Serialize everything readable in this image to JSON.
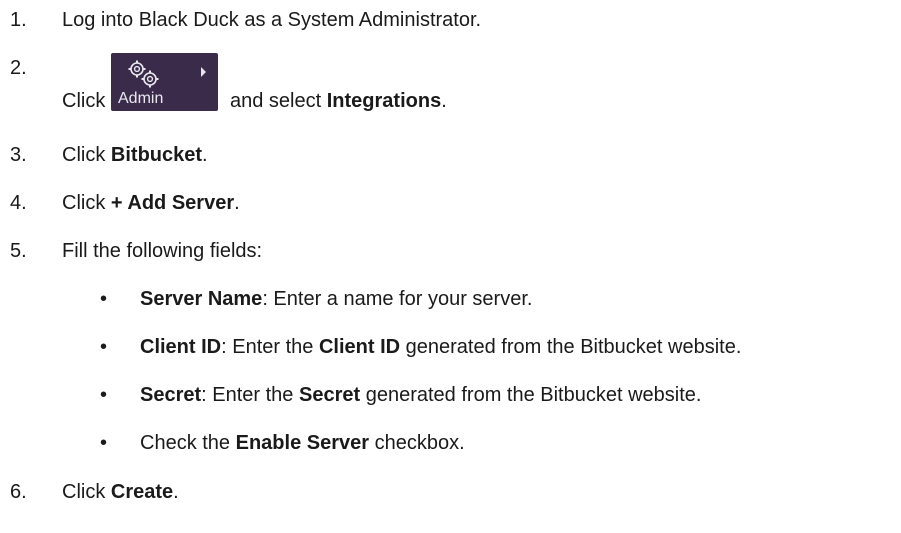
{
  "steps": [
    {
      "num": "1.",
      "text": "Log into Black Duck as a System Administrator."
    },
    {
      "num": "2.",
      "click": "Click",
      "after": "and select",
      "strong": "Integrations",
      "end": "."
    },
    {
      "num": "3.",
      "pre": "Click",
      "strong": "Bitbucket",
      "end": "."
    },
    {
      "num": "4.",
      "pre": "Click",
      "strong": "+ Add Server",
      "end": "."
    },
    {
      "num": "5.",
      "text": "Fill the following fields:"
    },
    {
      "num": "6.",
      "pre": "Click",
      "strong": "Create",
      "end": "."
    }
  ],
  "admin_badge": {
    "label": "Admin",
    "icon": "gears-icon",
    "bg": "#3b2b4a"
  },
  "sub_items": [
    {
      "bullet": "•",
      "strong": "Server Name",
      "rest": ": Enter a name for your server."
    },
    {
      "bullet": "•",
      "strong": "Client ID",
      "mid": ": Enter the",
      "strong2": "Client ID",
      "rest": "generated from the Bitbucket website."
    },
    {
      "bullet": "•",
      "strong": "Secret",
      "mid": ": Enter the",
      "strong2": "Secret",
      "rest": "generated from the Bitbucket website."
    },
    {
      "bullet": "•",
      "pre": "Check the",
      "strong": "Enable Server",
      "rest": "checkbox."
    }
  ]
}
